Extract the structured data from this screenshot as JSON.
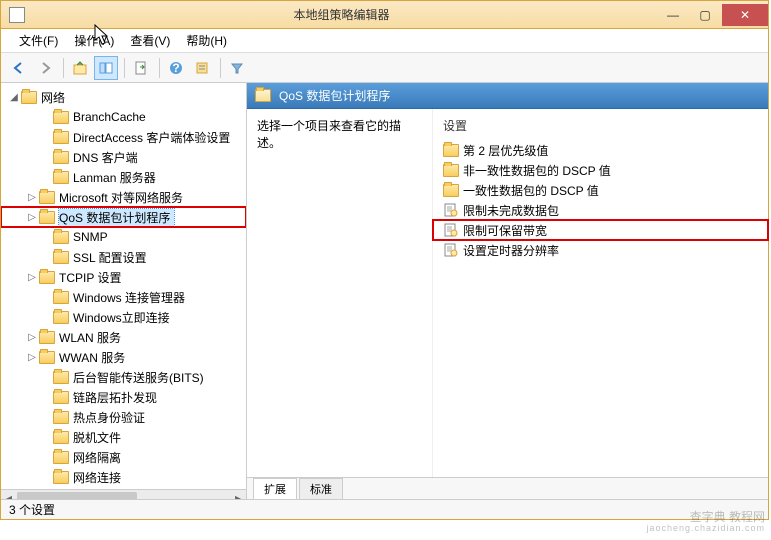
{
  "window": {
    "title": "本地组策略编辑器"
  },
  "menu": {
    "file": "文件(F)",
    "action": "操作(A)",
    "view": "查看(V)",
    "help": "帮助(H)"
  },
  "tree": {
    "root": "网络",
    "items": [
      {
        "label": "BranchCache",
        "indent": 38,
        "expander": ""
      },
      {
        "label": "DirectAccess 客户端体验设置",
        "indent": 38,
        "expander": ""
      },
      {
        "label": "DNS 客户端",
        "indent": 38,
        "expander": ""
      },
      {
        "label": "Lanman 服务器",
        "indent": 38,
        "expander": ""
      },
      {
        "label": "Microsoft 对等网络服务",
        "indent": 24,
        "expander": "▷"
      },
      {
        "label": "QoS 数据包计划程序",
        "indent": 24,
        "expander": "▷",
        "selected": true,
        "highlight": true
      },
      {
        "label": "SNMP",
        "indent": 38,
        "expander": ""
      },
      {
        "label": "SSL 配置设置",
        "indent": 38,
        "expander": ""
      },
      {
        "label": "TCPIP 设置",
        "indent": 24,
        "expander": "▷"
      },
      {
        "label": "Windows 连接管理器",
        "indent": 38,
        "expander": ""
      },
      {
        "label": "Windows立即连接",
        "indent": 38,
        "expander": ""
      },
      {
        "label": "WLAN 服务",
        "indent": 24,
        "expander": "▷"
      },
      {
        "label": "WWAN 服务",
        "indent": 24,
        "expander": "▷"
      },
      {
        "label": "后台智能传送服务(BITS)",
        "indent": 38,
        "expander": ""
      },
      {
        "label": "链路层拓扑发现",
        "indent": 38,
        "expander": ""
      },
      {
        "label": "热点身份验证",
        "indent": 38,
        "expander": ""
      },
      {
        "label": "脱机文件",
        "indent": 38,
        "expander": ""
      },
      {
        "label": "网络隔离",
        "indent": 38,
        "expander": ""
      },
      {
        "label": "网络连接",
        "indent": 38,
        "expander": ""
      }
    ]
  },
  "right": {
    "header": "QoS 数据包计划程序",
    "desc": "选择一个项目来查看它的描述。",
    "settings_label": "设置",
    "items": [
      {
        "type": "folder",
        "label": "第 2 层优先级值"
      },
      {
        "type": "folder",
        "label": "非一致性数据包的 DSCP 值"
      },
      {
        "type": "folder",
        "label": "一致性数据包的 DSCP 值"
      },
      {
        "type": "policy",
        "label": "限制未完成数据包"
      },
      {
        "type": "policy",
        "label": "限制可保留带宽",
        "highlight": true
      },
      {
        "type": "policy",
        "label": "设置定时器分辨率"
      }
    ]
  },
  "tabs": {
    "extended": "扩展",
    "standard": "标准"
  },
  "status": "3 个设置",
  "watermark": {
    "main": "查字典 教程网",
    "sub": "jaocheng.chazidian.com"
  }
}
